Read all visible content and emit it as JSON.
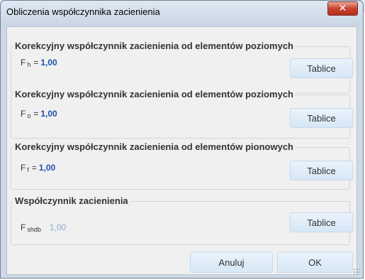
{
  "window": {
    "title": "Obliczenia współczynnika zacienienia",
    "close_symbol": "✕"
  },
  "groups": [
    {
      "title": "Korekcyjny współczynnik zacienienia od elementów poziomych",
      "symbol": "F",
      "subscript": "h",
      "equals": "=",
      "value": "1,00",
      "button": "Tablice"
    },
    {
      "title": "Korekcyjny współczynnik zacienienia od elementów poziomych",
      "symbol": "F",
      "subscript": "o",
      "equals": "=",
      "value": "1,00",
      "button": "Tablice"
    },
    {
      "title": "Korekcyjny współczynnik zacienienia od elementów pionowych",
      "symbol": "F",
      "subscript": "f",
      "equals": "=",
      "value": "1,00",
      "button": "Tablice"
    },
    {
      "title": "Współczynnik zacienienia",
      "symbol": "F",
      "subscript": "shdb",
      "value": "1,00",
      "button": "Tablice"
    }
  ],
  "footer": {
    "cancel_label": "Anuluj",
    "ok_label": "OK"
  },
  "colors": {
    "value_text": "#1f4fb0",
    "value_muted": "#8aaad8",
    "button_bg": "#d6e7f6",
    "close_button": "#c8432e"
  }
}
